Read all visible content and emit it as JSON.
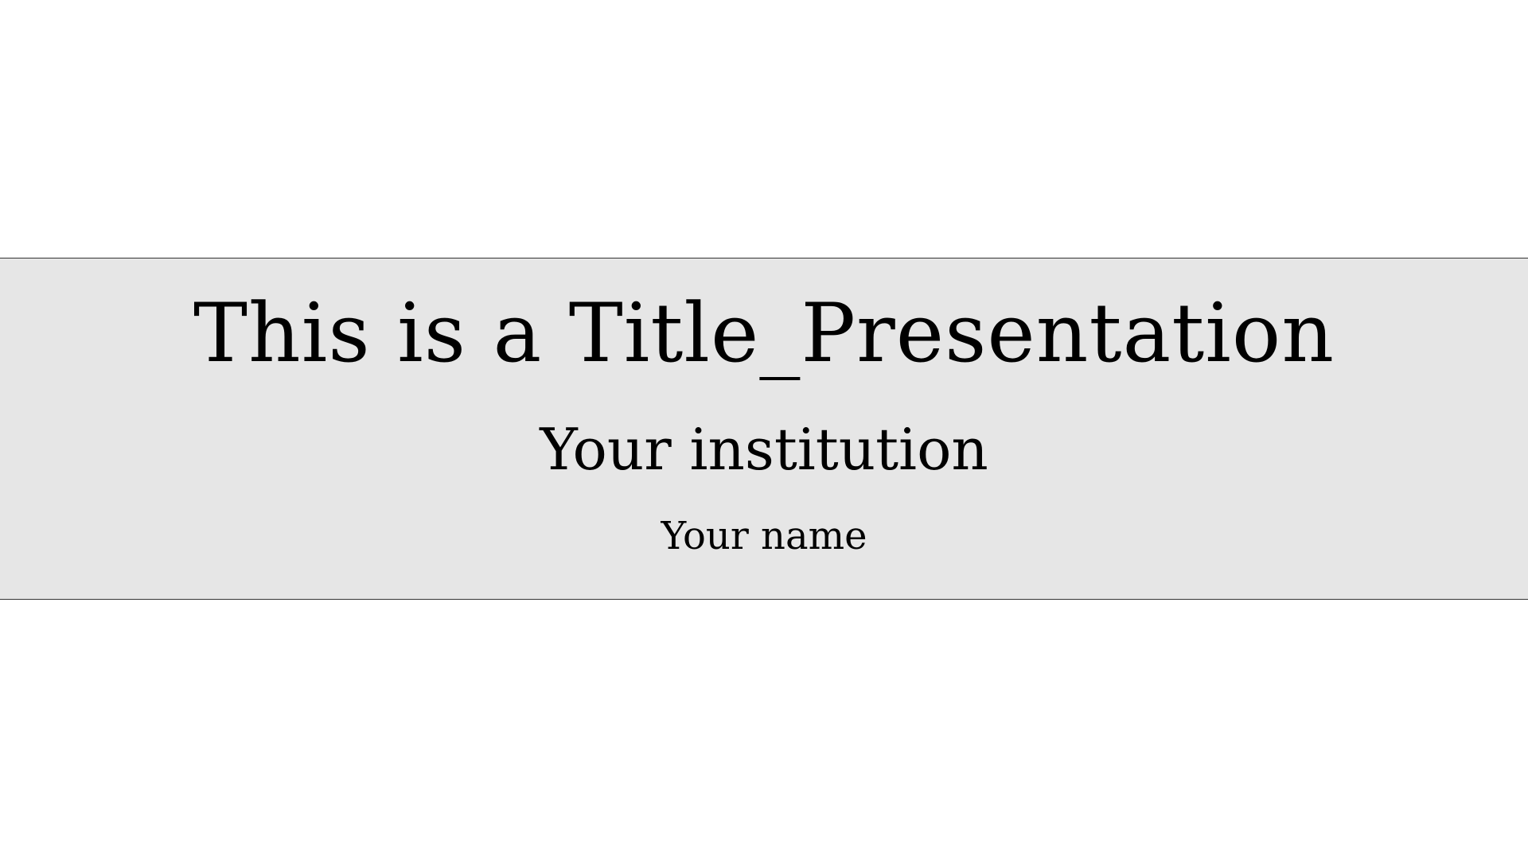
{
  "slide": {
    "title": "This is a Title_Presentation",
    "institution": "Your institution",
    "name": "Your name",
    "band_color": "#e6e6e6",
    "text_color": "#000000"
  }
}
